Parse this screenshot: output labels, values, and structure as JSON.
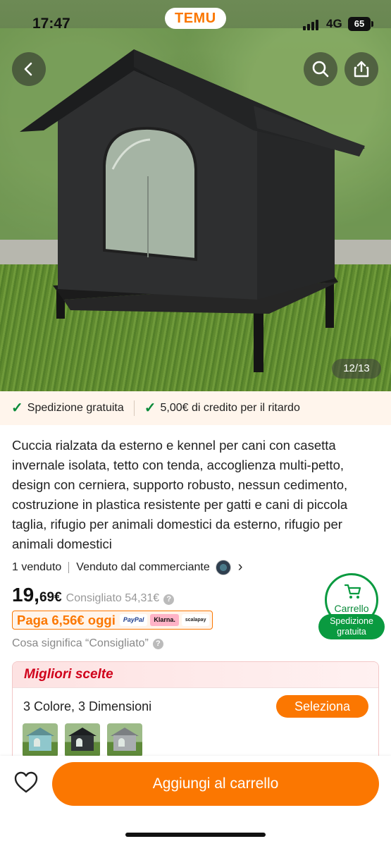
{
  "status_bar": {
    "time": "17:47",
    "network": "4G",
    "battery": "65"
  },
  "brand": "TEMU",
  "gallery": {
    "counter": "12/13"
  },
  "benefits": [
    {
      "label": "Spedizione gratuita"
    },
    {
      "label": "5,00€ di credito per il ritardo"
    }
  ],
  "product": {
    "title": "Cuccia rialzata da esterno e kennel per cani con casetta invernale isolata, tetto con tenda, accoglienza multi-petto, design con cerniera, supporto robusto, nessun cedimento, costruzione in plastica resistente per gatti e cani di piccola taglia, rifugio per animali domestici da esterno, rifugio per animali domestici",
    "sold": "1 venduto",
    "seller": "Venduto dal commerciante"
  },
  "price": {
    "integer": "19,",
    "decimal": "69€",
    "rrp": "Consigliato 54,31€",
    "pay_text": "Paga 6,56€ oggi",
    "pay_logos": [
      "PayPal",
      "Klarna.",
      "scalapay"
    ],
    "what_means": "Cosa significa “Consigliato”"
  },
  "cart_bubble": {
    "label": "Carrello",
    "shipping": "Spedizione gratuita"
  },
  "best_picks": {
    "header": "Migliori scelte",
    "variant_summary": "3 Colore, 3 Dimensioni",
    "select_label": "Seleziona",
    "thumbnails": [
      {
        "color": "#8fc7cc"
      },
      {
        "color": "#2f3436"
      },
      {
        "color": "#a9adb0"
      }
    ]
  },
  "bottom_bar": {
    "add_to_cart": "Aggiungi al carrello"
  },
  "colors": {
    "accent": "#fb7701",
    "green": "#0a9a40",
    "red": "#d0021b"
  }
}
